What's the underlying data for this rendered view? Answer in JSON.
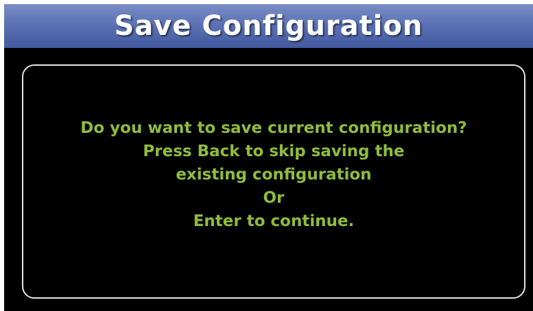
{
  "window": {
    "title": "Save Configuration"
  },
  "dialog": {
    "lines": [
      "Do you want to save current configuration?",
      "Press Back to skip saving the",
      "existing configuration",
      "Or",
      "Enter to continue."
    ]
  },
  "colors": {
    "title_bar": "#5c72b4",
    "message_text": "#8ebd3c",
    "background": "#000000",
    "border": "#e6e6e6"
  }
}
